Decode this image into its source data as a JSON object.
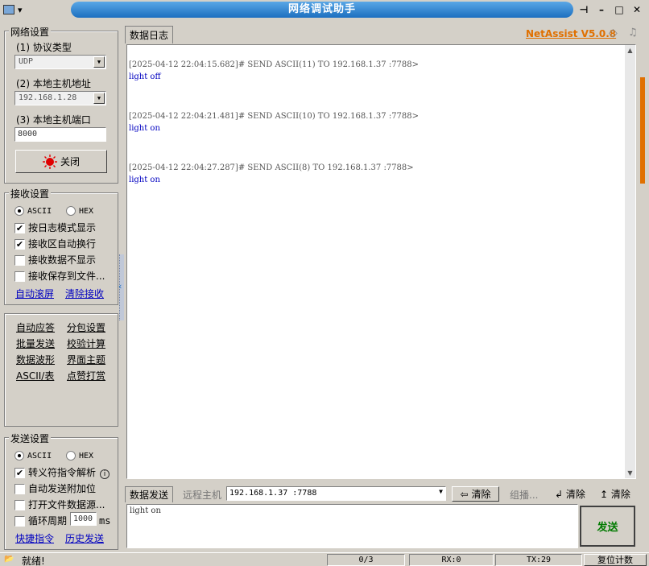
{
  "window": {
    "title": "网络调试助手"
  },
  "net_settings": {
    "title": "网络设置",
    "protocol_label": "(1) 协议类型",
    "protocol_value": "UDP",
    "host_label": "(2) 本地主机地址",
    "host_value": "192.168.1.28",
    "port_label": "(3) 本地主机端口",
    "port_value": "8000",
    "close_label": "关闭"
  },
  "recv_settings": {
    "title": "接收设置",
    "ascii": "ASCII",
    "hex": "HEX",
    "opt1": "按日志模式显示",
    "opt2": "接收区自动换行",
    "opt3": "接收数据不显示",
    "opt4": "接收保存到文件...",
    "auto_scroll": "自动滚屏",
    "clear_recv": "清除接收"
  },
  "tools": {
    "items": [
      "自动应答",
      "分包设置",
      "批量发送",
      "校验计算",
      "数据波形",
      "界面主题",
      "ASCII/表",
      "点赞打赏"
    ]
  },
  "send_settings": {
    "title": "发送设置",
    "ascii": "ASCII",
    "hex": "HEX",
    "opt1": "转义符指令解析",
    "opt2": "自动发送附加位",
    "opt3": "打开文件数据源...",
    "opt4": "循环周期",
    "cycle_value": "1000",
    "cycle_unit": "ms",
    "shortcut": "快捷指令",
    "history": "历史发送"
  },
  "log": {
    "tab": "数据日志",
    "brand": "NetAssist V5.0.8",
    "entries": [
      {
        "header": "[2025-04-12 22:04:15.682]# SEND ASCII(11) TO 192.168.1.37 :7788>",
        "body": "light off"
      },
      {
        "header": "[2025-04-12 22:04:21.481]# SEND ASCII(10) TO 192.168.1.37 :7788>",
        "body": "light on"
      },
      {
        "header": "[2025-04-12 22:04:27.287]# SEND ASCII(8) TO 192.168.1.37 :7788>",
        "body": "light on"
      }
    ]
  },
  "send": {
    "tab": "数据发送",
    "remote_label": "远程主机",
    "remote_value": "192.168.1.37 :7788",
    "clear1": "清除",
    "group_label": "组播...",
    "clear2": "清除",
    "clear3": "清除",
    "text": "light on",
    "send_label": "发送"
  },
  "status": {
    "ready": "就绪!",
    "count": "0/3",
    "rx": "RX:0",
    "tx": "TX:29",
    "reset": "复位计数"
  },
  "colors": {
    "accent": "#1c6fc0",
    "brand": "#e07000",
    "send_btn": "#007a00",
    "link": "#0000c0"
  }
}
